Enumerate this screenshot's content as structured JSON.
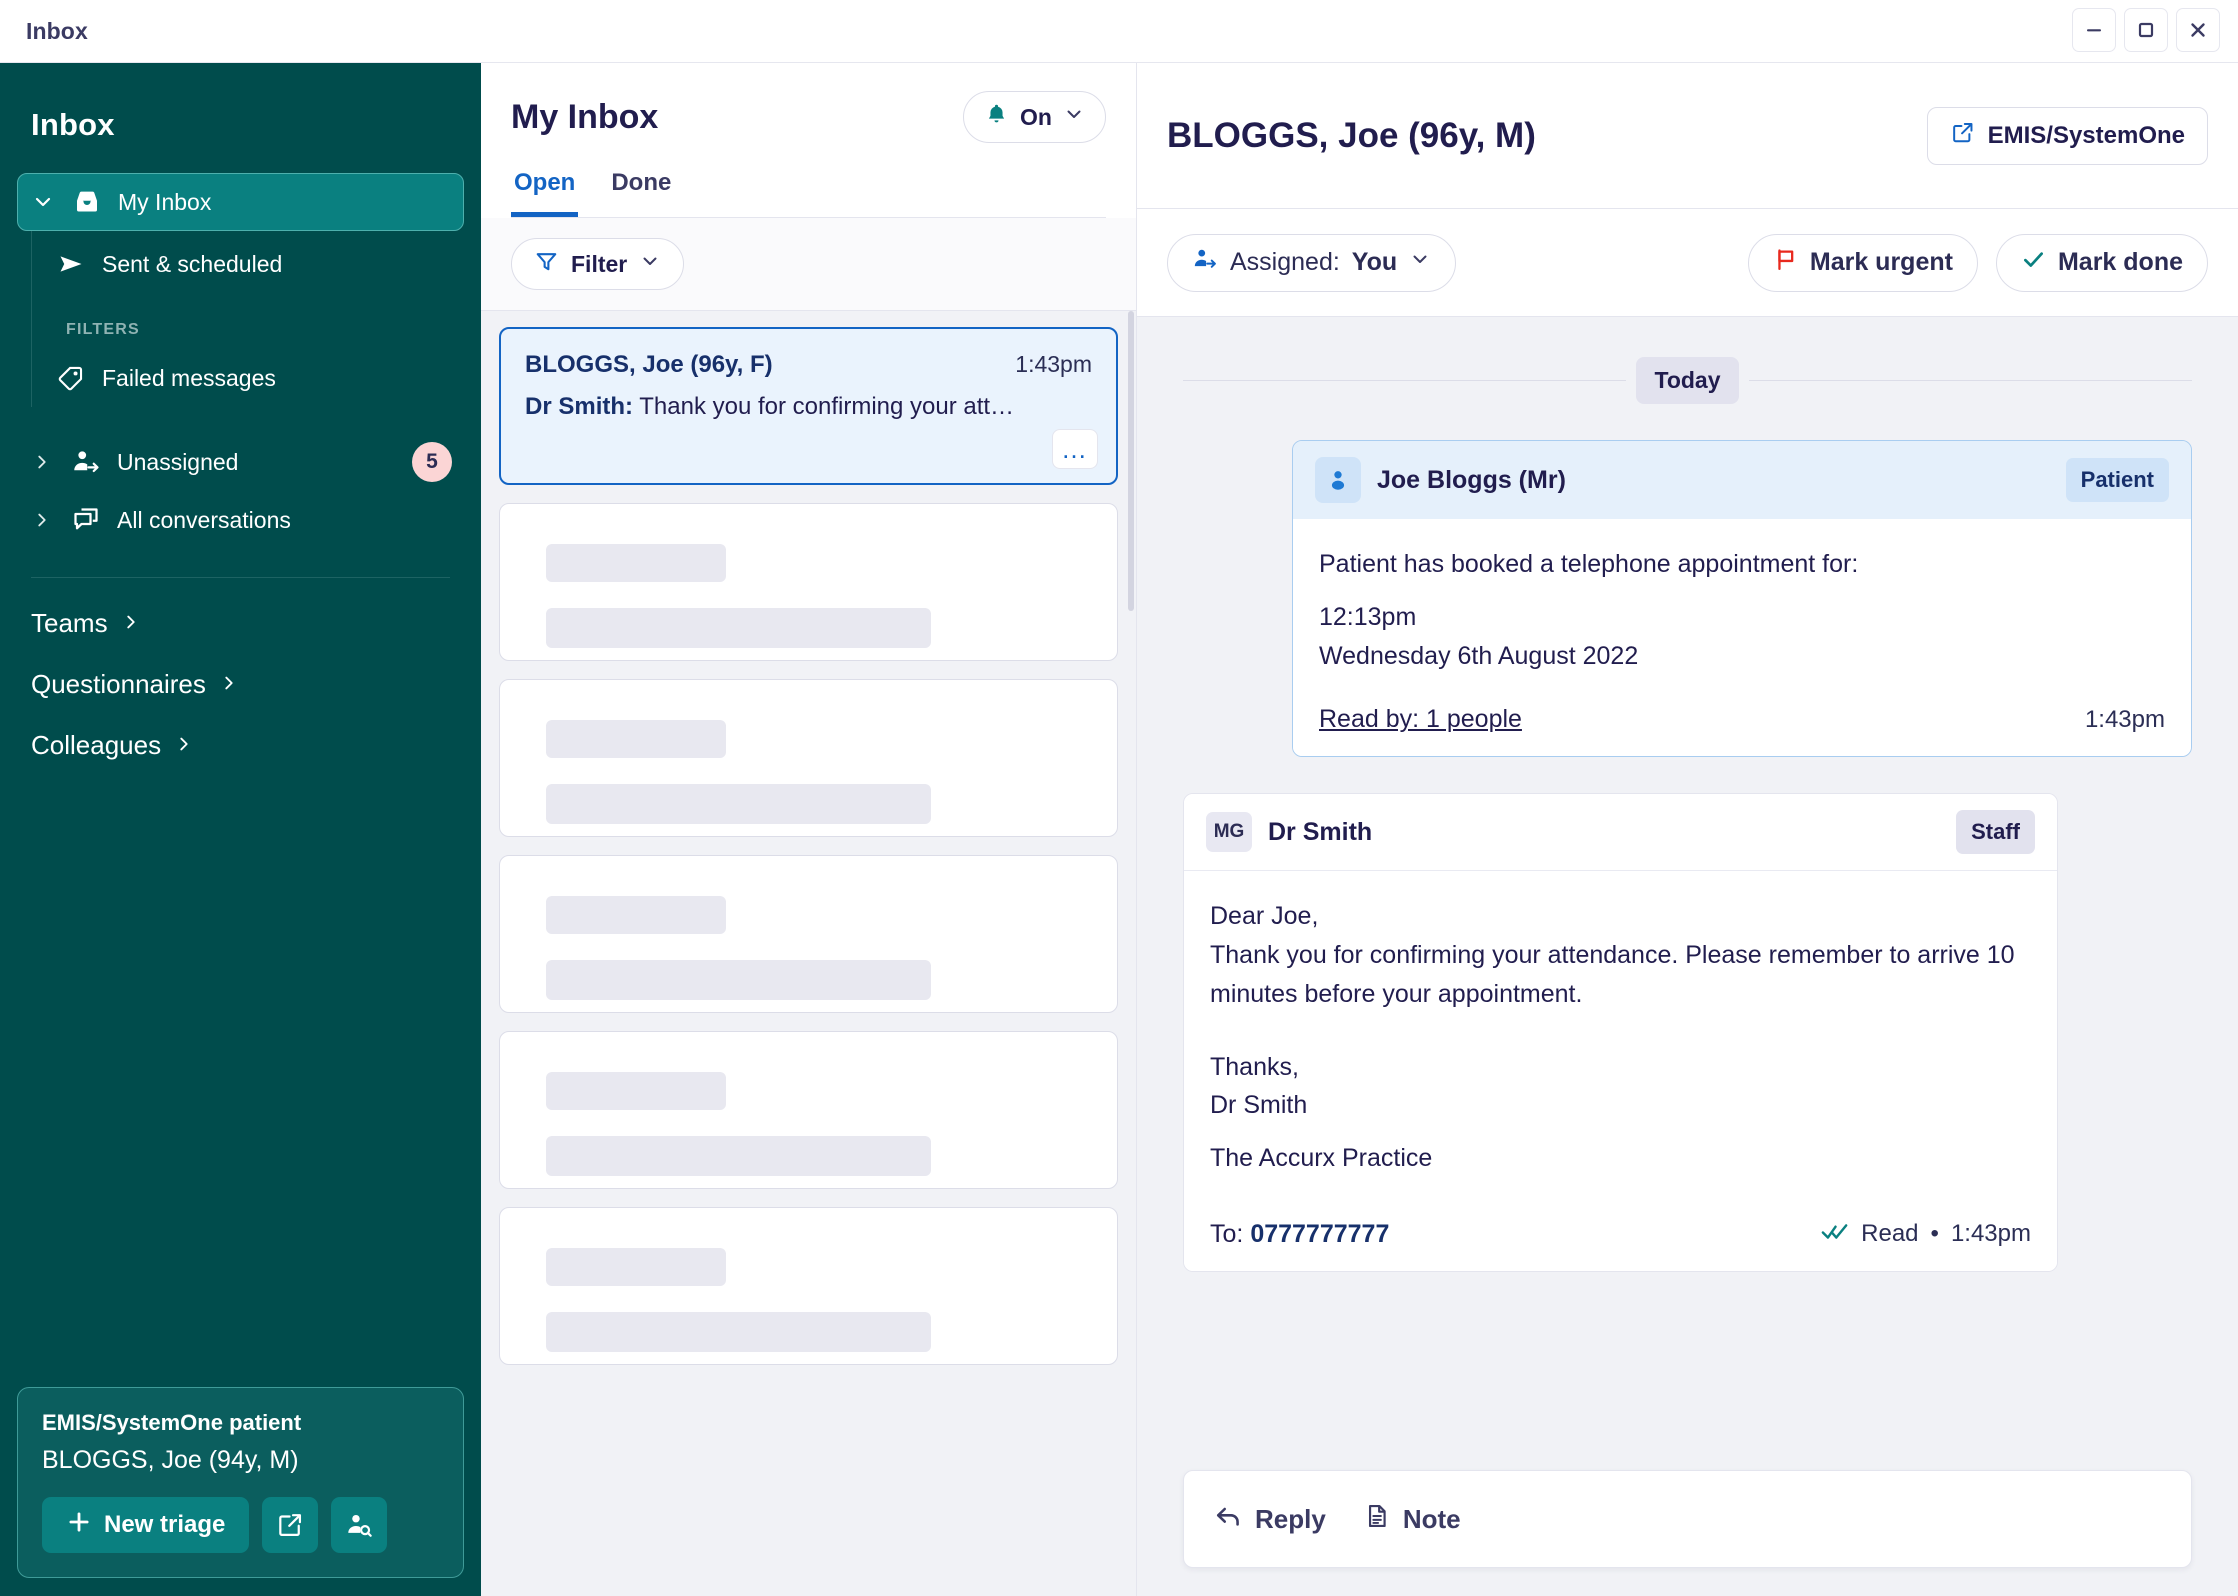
{
  "window": {
    "title": "Inbox",
    "controls": {
      "minimize": "minimize-button",
      "maximize": "maximize-button",
      "close": "close-button"
    }
  },
  "sidebar": {
    "heading": "Inbox",
    "primary": [
      {
        "label": "My Inbox",
        "icon": "inbox-icon",
        "active": true,
        "caret": "chevron-down-icon"
      }
    ],
    "sub": [
      {
        "label": "Sent & scheduled",
        "icon": "send-icon"
      }
    ],
    "filters_heading": "FILTERS",
    "filters": [
      {
        "label": "Failed messages",
        "icon": "tag-icon"
      }
    ],
    "groups": [
      {
        "label": "Unassigned",
        "icon": "assign-user-icon",
        "badge": "5",
        "caret": "chevron-right-icon"
      },
      {
        "label": "All conversations",
        "icon": "conversations-icon",
        "badge": "",
        "caret": "chevron-right-icon"
      }
    ],
    "links": [
      {
        "label": "Teams",
        "icon": "chevron-right-icon"
      },
      {
        "label": "Questionnaires",
        "icon": "chevron-right-icon"
      },
      {
        "label": "Colleagues",
        "icon": "chevron-right-icon"
      }
    ],
    "patient_card": {
      "title": "EMIS/SystemOne patient",
      "name": "BLOGGS, Joe (94y, M)",
      "new_triage_label": "New triage",
      "compose_icon": "compose-icon",
      "find_patient_icon": "find-patient-icon"
    }
  },
  "list": {
    "title": "My Inbox",
    "notify": {
      "label": "On",
      "icon": "bell-icon",
      "caret": "chevron-down-icon"
    },
    "tabs": [
      {
        "label": "Open",
        "active": true
      },
      {
        "label": "Done",
        "active": false
      }
    ],
    "filter": {
      "label": "Filter",
      "icon": "funnel-icon",
      "caret": "chevron-down-icon"
    },
    "selected_conversation": {
      "name": "BLOGGS, Joe (96y, F)",
      "time": "1:43pm",
      "sender": "Dr Smith:",
      "preview": "Thank you for confirming your att…",
      "more_icon": "more-options-icon"
    },
    "placeholder_count": 5
  },
  "detail": {
    "patient_title": "BLOGGS, Joe (96y, M)",
    "emis_button": {
      "label": "EMIS/SystemOne",
      "icon": "external-link-icon"
    },
    "assigned": {
      "prefix": "Assigned:",
      "value": "You",
      "icon": "assign-user-icon",
      "caret": "chevron-down-icon"
    },
    "mark_urgent": {
      "label": "Mark urgent",
      "icon": "flag-icon",
      "color": "#e8291e"
    },
    "mark_done": {
      "label": "Mark done",
      "icon": "check-icon",
      "color": "#0a8080"
    },
    "day_divider": "Today",
    "messages": [
      {
        "type": "patient",
        "author": "Joe Bloggs (Mr)",
        "role_badge": "Patient",
        "avatar_icon": "person-icon",
        "lines": [
          {
            "text": "Patient has booked a telephone appointment for:",
            "bold": false
          },
          {
            "text": "12:13pm",
            "bold": true
          },
          {
            "text": "Wednesday 6th August 2022",
            "bold": true
          }
        ],
        "read_by": "Read by: 1 people",
        "time": "1:43pm"
      },
      {
        "type": "staff",
        "author": "Dr Smith",
        "role_badge": "Staff",
        "avatar_initials": "MG",
        "lines": [
          {
            "text": "Dear Joe,",
            "bold": false
          },
          {
            "text": "Thank you for confirming your attendance. Please remember to arrive 10 minutes before your appointment.",
            "bold": false
          },
          {
            "text": "",
            "bold": false
          },
          {
            "text": "Thanks,",
            "bold": false
          },
          {
            "text": "Dr Smith",
            "bold": false
          },
          {
            "text": "The Accurx Practice",
            "bold": false
          }
        ],
        "to_label": "To:",
        "to_value": "0777777777",
        "status": "Read",
        "status_sep": "•",
        "time": "1:43pm",
        "status_icon": "double-check-icon"
      }
    ],
    "composer": [
      {
        "label": "Reply",
        "icon": "reply-icon"
      },
      {
        "label": "Note",
        "icon": "note-icon"
      }
    ]
  },
  "colors": {
    "sidebar_bg": "#004c4c",
    "sidebar_active": "#0a8080",
    "accent_blue": "#1364c4",
    "navy_text": "#211d4e",
    "badge_pink": "#fbd5d5",
    "urgent_red": "#e8291e",
    "teal": "#0a8080"
  }
}
